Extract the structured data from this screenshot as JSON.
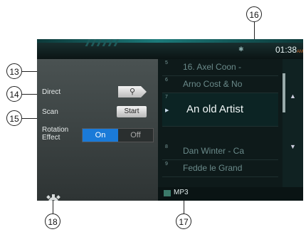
{
  "clock": {
    "time": "01:38",
    "ampm": "AM"
  },
  "settings": {
    "direct_label": "Direct",
    "scan_label": "Scan",
    "scan_button": "Start",
    "rotation_label_1": "Rotation",
    "rotation_label_2": "Effect",
    "rotation_on": "On",
    "rotation_off": "Off"
  },
  "tracks": [
    {
      "num": "5",
      "title": "16. Axel Coon -"
    },
    {
      "num": "6",
      "title": "Arno Cost & No"
    },
    {
      "num": "7",
      "title": "An old Artist"
    },
    {
      "num": "8",
      "title": "Dan Winter - Ca"
    },
    {
      "num": "9",
      "title": "Fedde le Grand"
    }
  ],
  "footer": {
    "source": "MP3"
  },
  "callouts": {
    "c13": "13",
    "c14": "14",
    "c15": "15",
    "c16": "16",
    "c17": "17",
    "c18": "18"
  },
  "icons": [
    "search-icon",
    "gear-icon",
    "bluetooth-icon",
    "folder-icon",
    "scroll-up-icon",
    "scroll-down-icon",
    "play-indicator-icon"
  ]
}
